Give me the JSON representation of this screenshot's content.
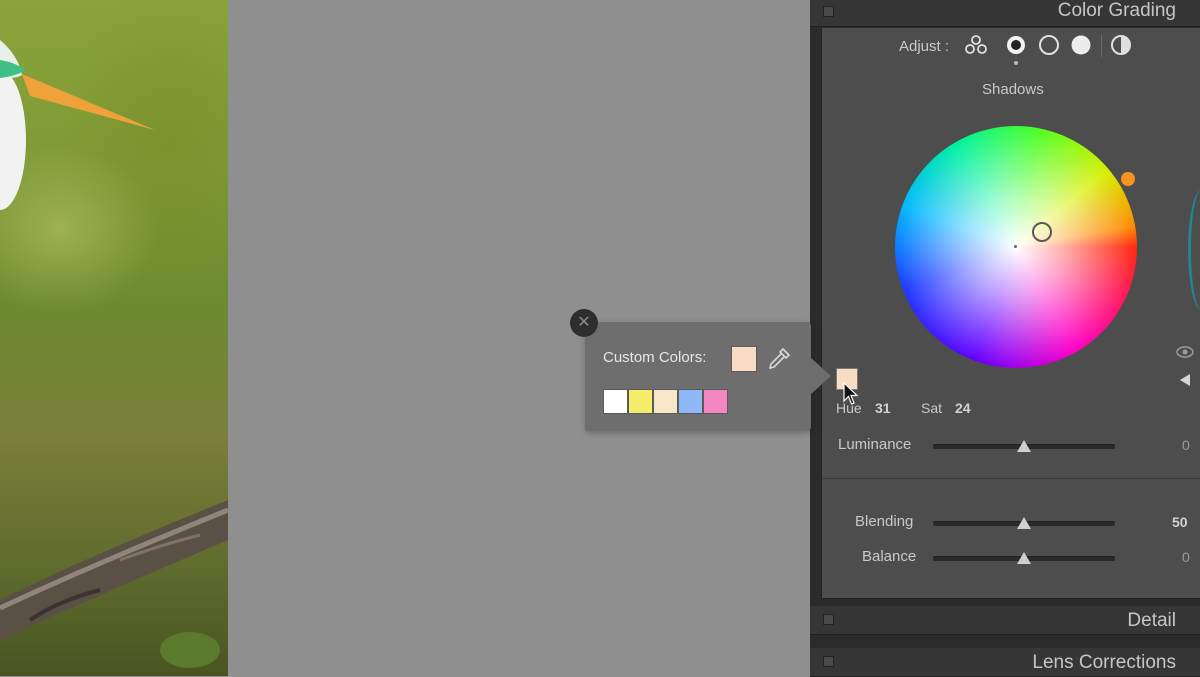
{
  "panel": {
    "color_grading_title": "Color Grading",
    "adjust_label": "Adjust :",
    "mode_label": "Shadows",
    "hue_label": "Hue",
    "hue_value": "31",
    "sat_label": "Sat",
    "sat_value": "24",
    "luminance_label": "Luminance",
    "luminance_value": "0",
    "blending_label": "Blending",
    "blending_value": "50",
    "balance_label": "Balance",
    "balance_value": "0",
    "detail_title": "Detail",
    "lens_title": "Lens Corrections",
    "selected_color": "#f8dcc4",
    "accent_dot_color": "#f7931e"
  },
  "popup": {
    "title": "Custom Colors:",
    "close_glyph": "✕",
    "current_color": "#f8dcc4",
    "swatches": [
      "#ffffff",
      "#f6ee6a",
      "#f8e6c8",
      "#8fb8f6",
      "#f387c2"
    ]
  },
  "icons": {
    "adjust_modes": [
      "three-way-icon",
      "shadows-icon",
      "midtones-icon",
      "highlights-icon",
      "global-icon"
    ],
    "eyedropper": "eyedropper-icon",
    "visibility": "eye-icon",
    "collapse": "triangle-left-icon"
  },
  "sliders": {
    "luminance": 0,
    "blending": 50,
    "balance": 0
  }
}
